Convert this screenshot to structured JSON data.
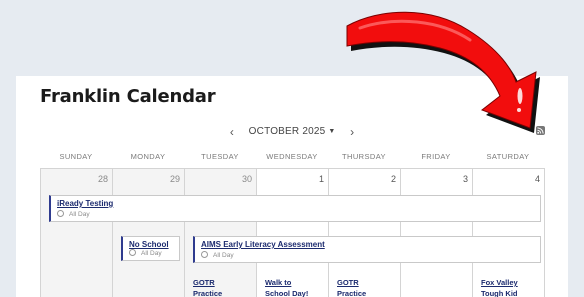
{
  "calendar": {
    "title": "Franklin Calendar",
    "nav": {
      "prev": "‹",
      "month": "OCTOBER 2025",
      "caret": "▼",
      "next": "›"
    },
    "feed_icon": "rss-icon",
    "days_of_week": [
      "SUNDAY",
      "MONDAY",
      "TUESDAY",
      "WEDNESDAY",
      "THURSDAY",
      "FRIDAY",
      "SATURDAY"
    ],
    "dates": [
      "28",
      "29",
      "30",
      "1",
      "2",
      "3",
      "4"
    ],
    "events": {
      "iready": {
        "title": "iReady Testing",
        "time": "All Day"
      },
      "no_school": {
        "title": "No School",
        "time": "All Day"
      },
      "aims": {
        "title": "AIMS Early Literacy Assessment",
        "time": "All Day"
      },
      "gotr_tue": {
        "line1": "GOTR",
        "line2": "Practice"
      },
      "walk": {
        "line1": "Walk to",
        "line2": "School Day!"
      },
      "gotr_thu": {
        "line1": "GOTR",
        "line2": "Practice"
      },
      "foxvalley": {
        "line1": "Fox Valley",
        "line2": "Tough Kid"
      }
    }
  },
  "colors": {
    "background": "#e6ebf1",
    "arrow_red": "#f20d0d",
    "event_title": "#1b2a6e",
    "event_accent": "#2f3b8f"
  },
  "overlay_icon": "red-curved-arrow-icon"
}
